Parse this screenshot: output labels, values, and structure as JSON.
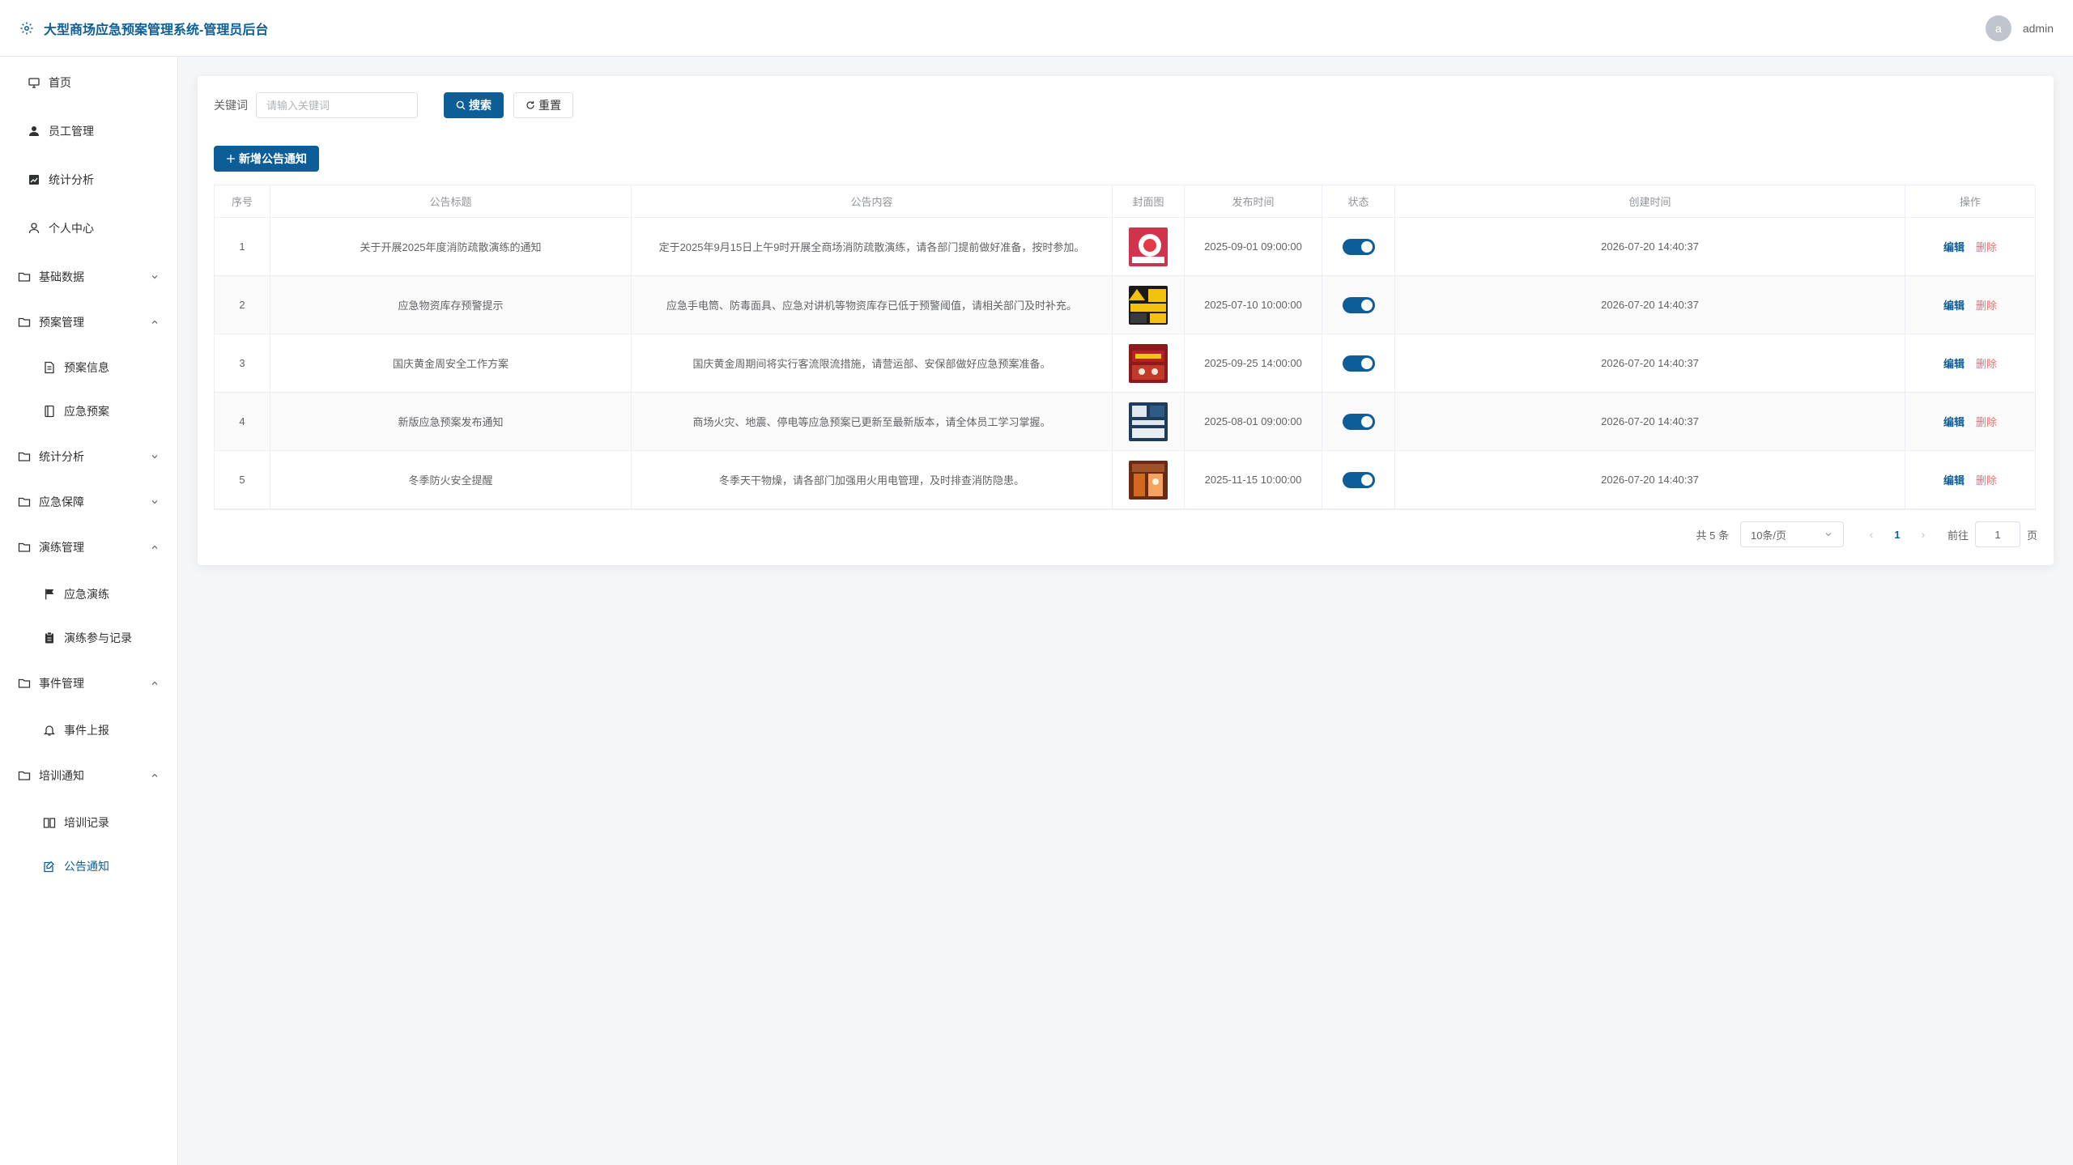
{
  "header": {
    "title": "大型商场应急预案管理系统-管理员后台",
    "avatar_letter": "a",
    "user_name": "admin"
  },
  "sidebar": {
    "items": [
      {
        "label": "首页",
        "icon": "monitor-icon"
      },
      {
        "label": "员工管理",
        "icon": "user-filled-icon"
      },
      {
        "label": "统计分析",
        "icon": "chart-icon"
      },
      {
        "label": "个人中心",
        "icon": "user-icon"
      },
      {
        "label": "基础数据",
        "icon": "folder-icon",
        "expanded": false
      },
      {
        "label": "预案管理",
        "icon": "folder-icon",
        "expanded": true
      },
      {
        "label": "预案信息",
        "icon": "document-icon"
      },
      {
        "label": "应急预案",
        "icon": "notebook-icon"
      },
      {
        "label": "统计分析",
        "icon": "folder-icon",
        "expanded": false
      },
      {
        "label": "应急保障",
        "icon": "folder-icon",
        "expanded": false
      },
      {
        "label": "演练管理",
        "icon": "folder-icon",
        "expanded": true
      },
      {
        "label": "应急演练",
        "icon": "flag-icon"
      },
      {
        "label": "演练参与记录",
        "icon": "clipboard-icon"
      },
      {
        "label": "事件管理",
        "icon": "folder-icon",
        "expanded": true
      },
      {
        "label": "事件上报",
        "icon": "bell-icon"
      },
      {
        "label": "培训通知",
        "icon": "folder-icon",
        "expanded": true
      },
      {
        "label": "培训记录",
        "icon": "book-icon"
      },
      {
        "label": "公告通知",
        "icon": "edit-note-icon",
        "active": true
      }
    ]
  },
  "search": {
    "label": "关键词",
    "placeholder": "请输入关键词",
    "value": "",
    "search_button": "搜索",
    "reset_button": "重置"
  },
  "toolbar": {
    "add_button": "新增公告通知"
  },
  "table": {
    "columns": [
      "序号",
      "公告标题",
      "公告内容",
      "封面图",
      "发布时间",
      "状态",
      "创建时间",
      "操作"
    ],
    "rows": [
      {
        "index": "1",
        "title": "关于开展2025年度消防疏散演练的通知",
        "content": "定于2025年9月15日上午9时开展全商场消防疏散演练，请各部门提前做好准备，按时参加。",
        "publish_time": "2025-09-01 09:00:00",
        "status": true,
        "created": "2026-07-20 14:40:37"
      },
      {
        "index": "2",
        "title": "应急物资库存预警提示",
        "content": "应急手电筒、防毒面具、应急对讲机等物资库存已低于预警阈值，请相关部门及时补充。",
        "publish_time": "2025-07-10 10:00:00",
        "status": true,
        "created": "2026-07-20 14:40:37"
      },
      {
        "index": "3",
        "title": "国庆黄金周安全工作方案",
        "content": "国庆黄金周期间将实行客流限流措施，请营运部、安保部做好应急预案准备。",
        "publish_time": "2025-09-25 14:00:00",
        "status": true,
        "created": "2026-07-20 14:40:37"
      },
      {
        "index": "4",
        "title": "新版应急预案发布通知",
        "content": "商场火灾、地震、停电等应急预案已更新至最新版本，请全体员工学习掌握。",
        "publish_time": "2025-08-01 09:00:00",
        "status": true,
        "created": "2026-07-20 14:40:37"
      },
      {
        "index": "5",
        "title": "冬季防火安全提醒",
        "content": "冬季天干物燥，请各部门加强用火用电管理，及时排查消防隐患。",
        "publish_time": "2025-11-15 10:00:00",
        "status": true,
        "created": "2026-07-20 14:40:37"
      }
    ],
    "edit_label": "编辑",
    "delete_label": "删除"
  },
  "pagination": {
    "total": "共 5 条",
    "page_size": "10条/页",
    "current_page": "1",
    "goto_label": "前往",
    "goto_value": "1",
    "page_unit": "页"
  },
  "colors": {
    "primary": "#0d5e97",
    "danger": "#f56c6c"
  }
}
